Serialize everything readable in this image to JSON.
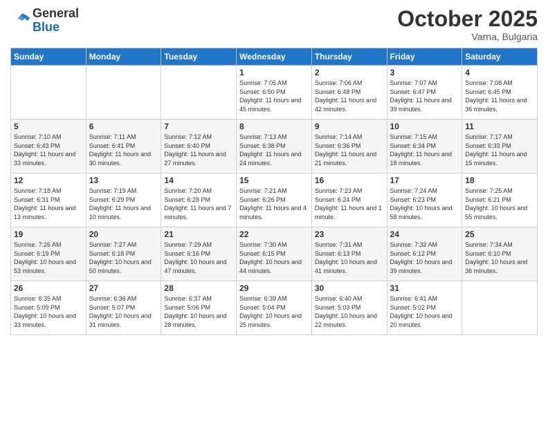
{
  "logo": {
    "general": "General",
    "blue": "Blue"
  },
  "header": {
    "month": "October 2025",
    "location": "Varna, Bulgaria"
  },
  "weekdays": [
    "Sunday",
    "Monday",
    "Tuesday",
    "Wednesday",
    "Thursday",
    "Friday",
    "Saturday"
  ],
  "weeks": [
    [
      {
        "day": "",
        "sunrise": "",
        "sunset": "",
        "daylight": ""
      },
      {
        "day": "",
        "sunrise": "",
        "sunset": "",
        "daylight": ""
      },
      {
        "day": "",
        "sunrise": "",
        "sunset": "",
        "daylight": ""
      },
      {
        "day": "1",
        "sunrise": "Sunrise: 7:05 AM",
        "sunset": "Sunset: 6:50 PM",
        "daylight": "Daylight: 11 hours and 45 minutes."
      },
      {
        "day": "2",
        "sunrise": "Sunrise: 7:06 AM",
        "sunset": "Sunset: 6:48 PM",
        "daylight": "Daylight: 11 hours and 42 minutes."
      },
      {
        "day": "3",
        "sunrise": "Sunrise: 7:07 AM",
        "sunset": "Sunset: 6:47 PM",
        "daylight": "Daylight: 11 hours and 39 minutes."
      },
      {
        "day": "4",
        "sunrise": "Sunrise: 7:08 AM",
        "sunset": "Sunset: 6:45 PM",
        "daylight": "Daylight: 11 hours and 36 minutes."
      }
    ],
    [
      {
        "day": "5",
        "sunrise": "Sunrise: 7:10 AM",
        "sunset": "Sunset: 6:43 PM",
        "daylight": "Daylight: 11 hours and 33 minutes."
      },
      {
        "day": "6",
        "sunrise": "Sunrise: 7:11 AM",
        "sunset": "Sunset: 6:41 PM",
        "daylight": "Daylight: 11 hours and 30 minutes."
      },
      {
        "day": "7",
        "sunrise": "Sunrise: 7:12 AM",
        "sunset": "Sunset: 6:40 PM",
        "daylight": "Daylight: 11 hours and 27 minutes."
      },
      {
        "day": "8",
        "sunrise": "Sunrise: 7:13 AM",
        "sunset": "Sunset: 6:38 PM",
        "daylight": "Daylight: 11 hours and 24 minutes."
      },
      {
        "day": "9",
        "sunrise": "Sunrise: 7:14 AM",
        "sunset": "Sunset: 6:36 PM",
        "daylight": "Daylight: 11 hours and 21 minutes."
      },
      {
        "day": "10",
        "sunrise": "Sunrise: 7:15 AM",
        "sunset": "Sunset: 6:34 PM",
        "daylight": "Daylight: 11 hours and 18 minutes."
      },
      {
        "day": "11",
        "sunrise": "Sunrise: 7:17 AM",
        "sunset": "Sunset: 6:33 PM",
        "daylight": "Daylight: 11 hours and 15 minutes."
      }
    ],
    [
      {
        "day": "12",
        "sunrise": "Sunrise: 7:18 AM",
        "sunset": "Sunset: 6:31 PM",
        "daylight": "Daylight: 11 hours and 13 minutes."
      },
      {
        "day": "13",
        "sunrise": "Sunrise: 7:19 AM",
        "sunset": "Sunset: 6:29 PM",
        "daylight": "Daylight: 11 hours and 10 minutes."
      },
      {
        "day": "14",
        "sunrise": "Sunrise: 7:20 AM",
        "sunset": "Sunset: 6:28 PM",
        "daylight": "Daylight: 11 hours and 7 minutes."
      },
      {
        "day": "15",
        "sunrise": "Sunrise: 7:21 AM",
        "sunset": "Sunset: 6:26 PM",
        "daylight": "Daylight: 11 hours and 4 minutes."
      },
      {
        "day": "16",
        "sunrise": "Sunrise: 7:23 AM",
        "sunset": "Sunset: 6:24 PM",
        "daylight": "Daylight: 11 hours and 1 minute."
      },
      {
        "day": "17",
        "sunrise": "Sunrise: 7:24 AM",
        "sunset": "Sunset: 6:23 PM",
        "daylight": "Daylight: 10 hours and 58 minutes."
      },
      {
        "day": "18",
        "sunrise": "Sunrise: 7:25 AM",
        "sunset": "Sunset: 6:21 PM",
        "daylight": "Daylight: 10 hours and 55 minutes."
      }
    ],
    [
      {
        "day": "19",
        "sunrise": "Sunrise: 7:26 AM",
        "sunset": "Sunset: 6:19 PM",
        "daylight": "Daylight: 10 hours and 53 minutes."
      },
      {
        "day": "20",
        "sunrise": "Sunrise: 7:27 AM",
        "sunset": "Sunset: 6:18 PM",
        "daylight": "Daylight: 10 hours and 50 minutes."
      },
      {
        "day": "21",
        "sunrise": "Sunrise: 7:29 AM",
        "sunset": "Sunset: 6:16 PM",
        "daylight": "Daylight: 10 hours and 47 minutes."
      },
      {
        "day": "22",
        "sunrise": "Sunrise: 7:30 AM",
        "sunset": "Sunset: 6:15 PM",
        "daylight": "Daylight: 10 hours and 44 minutes."
      },
      {
        "day": "23",
        "sunrise": "Sunrise: 7:31 AM",
        "sunset": "Sunset: 6:13 PM",
        "daylight": "Daylight: 10 hours and 41 minutes."
      },
      {
        "day": "24",
        "sunrise": "Sunrise: 7:32 AM",
        "sunset": "Sunset: 6:12 PM",
        "daylight": "Daylight: 10 hours and 39 minutes."
      },
      {
        "day": "25",
        "sunrise": "Sunrise: 7:34 AM",
        "sunset": "Sunset: 6:10 PM",
        "daylight": "Daylight: 10 hours and 36 minutes."
      }
    ],
    [
      {
        "day": "26",
        "sunrise": "Sunrise: 6:35 AM",
        "sunset": "Sunset: 5:09 PM",
        "daylight": "Daylight: 10 hours and 33 minutes."
      },
      {
        "day": "27",
        "sunrise": "Sunrise: 6:36 AM",
        "sunset": "Sunset: 5:07 PM",
        "daylight": "Daylight: 10 hours and 31 minutes."
      },
      {
        "day": "28",
        "sunrise": "Sunrise: 6:37 AM",
        "sunset": "Sunset: 5:06 PM",
        "daylight": "Daylight: 10 hours and 28 minutes."
      },
      {
        "day": "29",
        "sunrise": "Sunrise: 6:39 AM",
        "sunset": "Sunset: 5:04 PM",
        "daylight": "Daylight: 10 hours and 25 minutes."
      },
      {
        "day": "30",
        "sunrise": "Sunrise: 6:40 AM",
        "sunset": "Sunset: 5:03 PM",
        "daylight": "Daylight: 10 hours and 22 minutes."
      },
      {
        "day": "31",
        "sunrise": "Sunrise: 6:41 AM",
        "sunset": "Sunset: 5:02 PM",
        "daylight": "Daylight: 10 hours and 20 minutes."
      },
      {
        "day": "",
        "sunrise": "",
        "sunset": "",
        "daylight": ""
      }
    ]
  ]
}
